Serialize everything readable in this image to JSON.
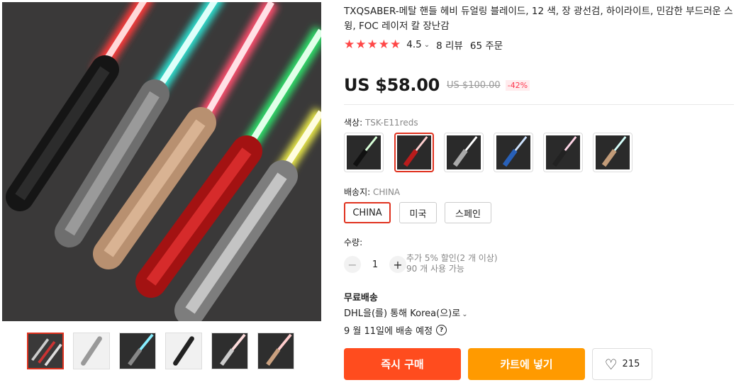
{
  "product": {
    "title": "TXQSABER-메탈 핸들 헤비 듀얼링 블레이드, 12 색, 장 광선검, 하이라이트, 민감한 부드러운 스윙, FOC 레이저 칼 장난감",
    "rating": "4.5",
    "reviews": "8 리뷰",
    "orders": "65 주문",
    "stars": 5
  },
  "price": {
    "current": "US $58.00",
    "original": "US $100.00",
    "discount": "-42%"
  },
  "color": {
    "label": "색상:",
    "selected": "TSK-E11reds",
    "options": [
      "black-green",
      "black-red",
      "silver-white",
      "blue",
      "black-pink",
      "gold-cyan"
    ],
    "selected_index": 1
  },
  "shipping": {
    "label": "배송지:",
    "selected": "CHINA",
    "options": [
      "CHINA",
      "미국",
      "스페인"
    ]
  },
  "quantity": {
    "label": "수량:",
    "value": "1",
    "minus": "−",
    "plus": "+",
    "note_line1": "추가 5% 할인(2 개 이상)",
    "note_line2": "90 개 사용 가능"
  },
  "delivery": {
    "free_shipping": "무료배송",
    "via": "DHL을(를) 통해 Korea(으)로",
    "date_prefix": "9 월 11일",
    "date_suffix": "에 배송 예정",
    "help": "?"
  },
  "actions": {
    "buy_now": "즉시 구매",
    "add_to_cart": "카트에 넣기",
    "wishlist_count": "215"
  },
  "colors": {
    "accent": "#ff4c1e",
    "cart": "#ff9a00",
    "star": "#ff4747",
    "selected_border": "#e0321f"
  }
}
